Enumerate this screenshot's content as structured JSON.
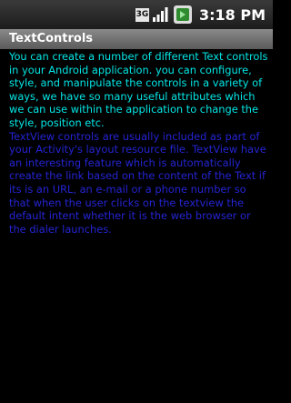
{
  "status_bar": {
    "network_type": "3G",
    "time": "3:18 PM",
    "icons": [
      "network-3g-icon",
      "signal-strength-icon",
      "battery-charging-icon"
    ]
  },
  "title_bar": {
    "title": "TextControls"
  },
  "content": {
    "paragraph1": "You can create a number of different Text controls in your Android application. you can configure, style, and manipulate the controls in a variety of ways, we have so many useful attributes which we can use within the application to change the style, position etc.",
    "paragraph2": "TextView controls are usually included as part of your Activity's layout resource file. TextView have an interesting feature which is automatically create the link based on the content of the Text if its is an URL, an e-mail or a phone number so that when the user clicks on the textview the default intent whether it is the web browser or the dialer launches."
  },
  "colors": {
    "background": "#000000",
    "paragraph1": "#00e6e6",
    "paragraph2": "#2424d4",
    "title_bar": "#707070"
  }
}
